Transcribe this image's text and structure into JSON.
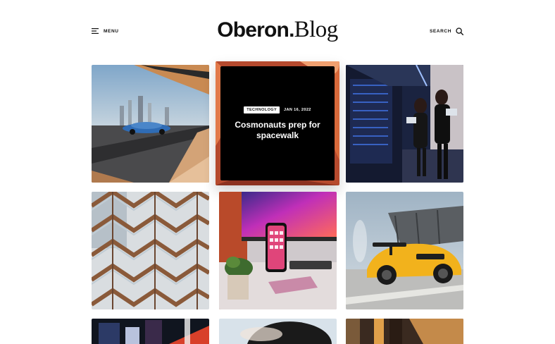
{
  "header": {
    "menu_label": "MENU",
    "search_label": "SEARCH",
    "logo_main": "Oberon.",
    "logo_suffix": "Blog"
  },
  "featured_post": {
    "category": "TECHNOLOGY",
    "date": "JAN 16, 2022",
    "title": "Cosmonauts prep for spacewalk"
  },
  "posts": [
    {
      "image": "sports-car-under-overpass"
    },
    {
      "image": "featured-technology"
    },
    {
      "image": "women-in-server-room"
    },
    {
      "image": "honeycomb-staircase-structure"
    },
    {
      "image": "iphone-on-desk-with-monitor"
    },
    {
      "image": "yellow-porsche-with-spoiler"
    },
    {
      "image": "city-night-neon"
    },
    {
      "image": "woman-hair-portrait"
    },
    {
      "image": "wooden-interior"
    }
  ]
}
